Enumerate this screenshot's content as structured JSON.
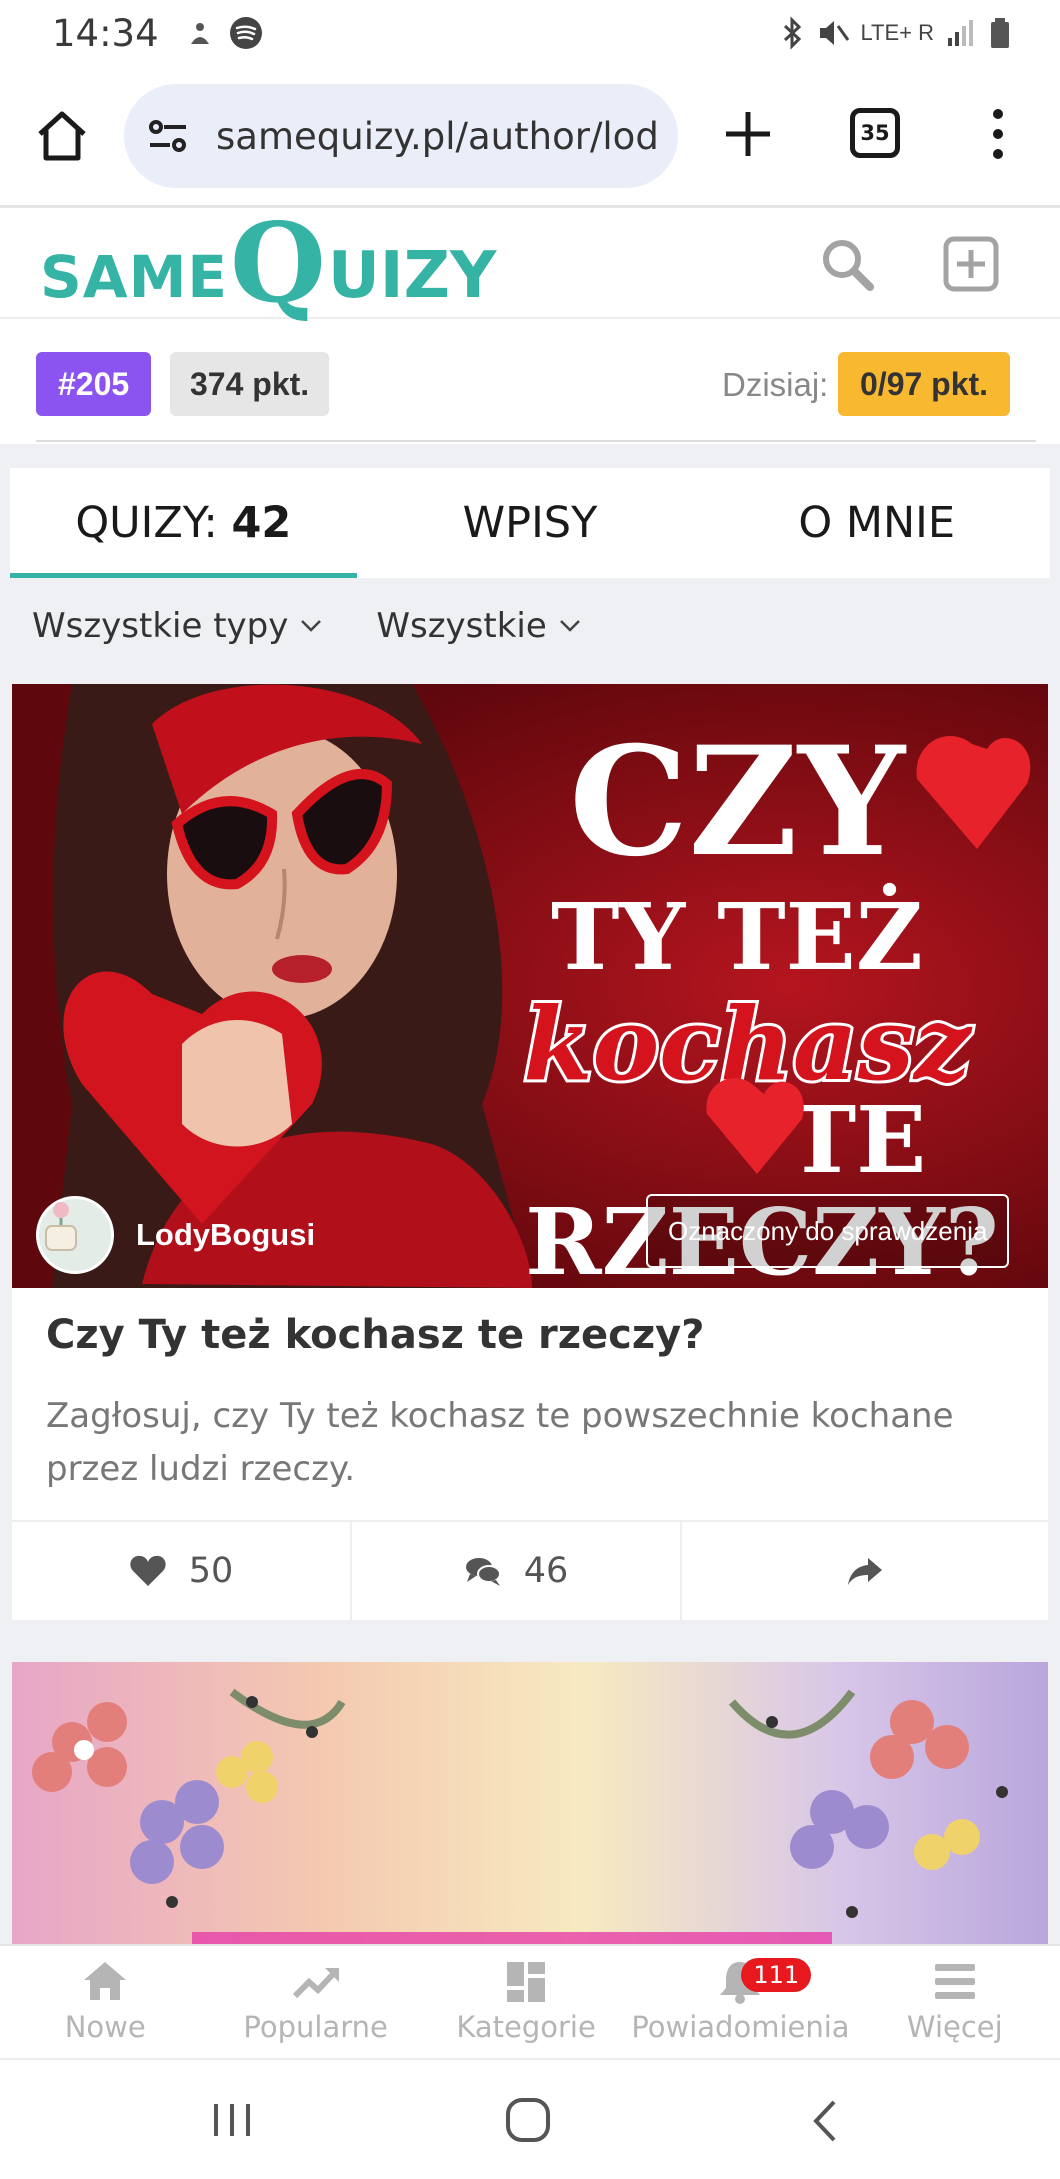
{
  "status": {
    "time": "14:34",
    "network": "LTE+ R"
  },
  "browser": {
    "url": "samequizy.pl/author/lod",
    "tab_count": "35"
  },
  "site": {
    "logo_pre": "SAME",
    "logo_q": "Q",
    "logo_post": "UIZY"
  },
  "points": {
    "rank": "#205",
    "points": "374 pkt.",
    "today_label": "Dzisiaj:",
    "today_value": "0/97 pkt."
  },
  "tabs": {
    "quizzes_label": "QUIZY: ",
    "quizzes_count": "42",
    "posts": "WPISY",
    "about": "O MNIE"
  },
  "filters": {
    "type": "Wszystkie typy",
    "scope": "Wszystkie"
  },
  "card": {
    "author": "LodyBogusi",
    "flag": "Oznaczony do sprawdzenia",
    "title": "Czy Ty też kochasz te rzeczy?",
    "description": "Zagłosuj, czy Ty też kochasz te powszechnie kochane przez ludzi rzeczy.",
    "likes": "50",
    "comments": "46",
    "hero_text": {
      "line1": "CZY",
      "line2": "TY TEŻ",
      "line3": "kochasz",
      "line4": "TE",
      "line5": "RZECZY?"
    }
  },
  "bottom_nav": {
    "new": "Nowe",
    "popular": "Popularne",
    "categories": "Kategorie",
    "notifications": "Powiadomienia",
    "notifications_count": "111",
    "more": "Więcej"
  },
  "colors": {
    "brand": "#35b3a4",
    "rank": "#8b54f1",
    "today": "#f8b830",
    "badge": "#e8181f"
  }
}
